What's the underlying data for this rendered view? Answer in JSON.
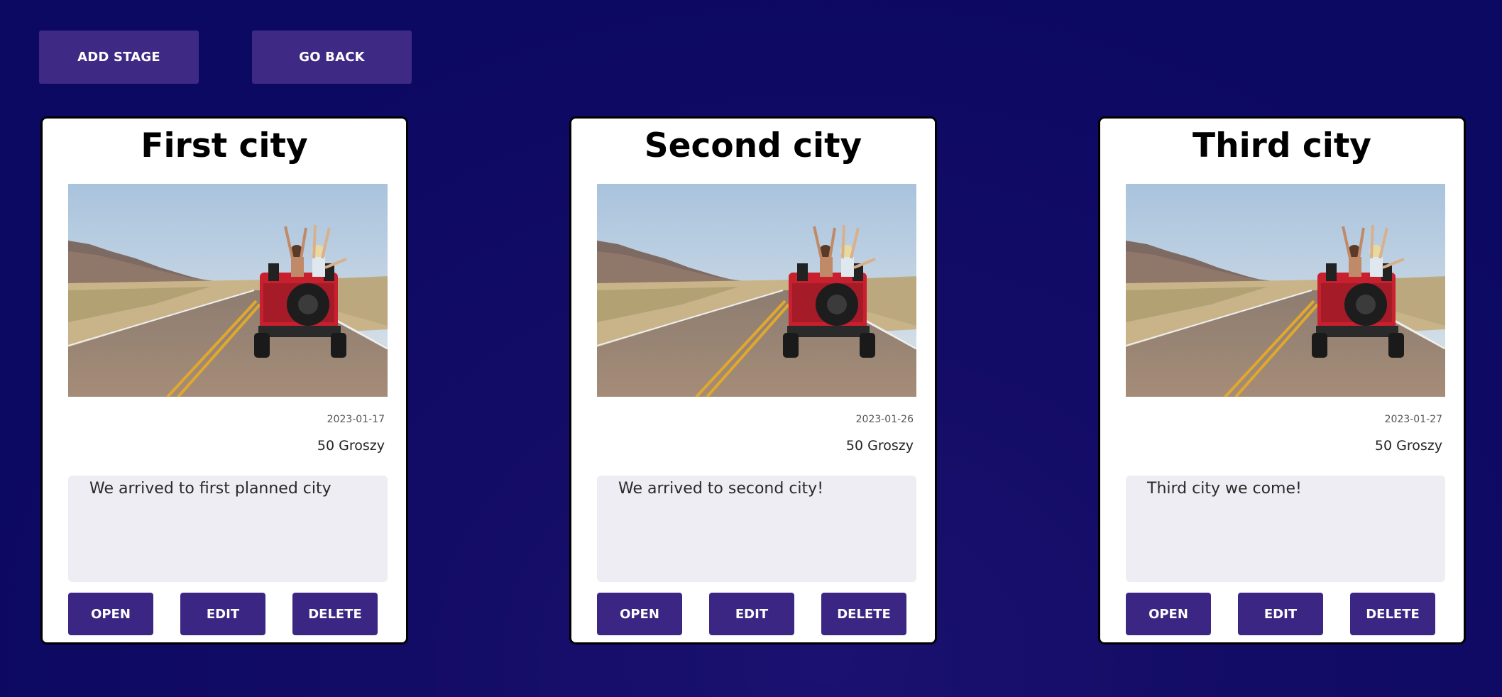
{
  "toolbar": {
    "add_stage_label": "ADD STAGE",
    "go_back_label": "GO BACK"
  },
  "stages": [
    {
      "title": "First city",
      "date": "2023-01-17",
      "price": "50 Groszy",
      "description": "We arrived to first planned city",
      "open_label": "OPEN",
      "edit_label": "EDIT",
      "delete_label": "DELETE"
    },
    {
      "title": "Second city",
      "date": "2023-01-26",
      "price": "50 Groszy",
      "description": "We arrived to second city!",
      "open_label": "OPEN",
      "edit_label": "EDIT",
      "delete_label": "DELETE"
    },
    {
      "title": "Third city",
      "date": "2023-01-27",
      "price": "50 Groszy",
      "description": "Third city we come!",
      "open_label": "OPEN",
      "edit_label": "EDIT",
      "delete_label": "DELETE"
    }
  ],
  "colors": {
    "background": "#0c0963",
    "button": "#3e2a85",
    "card_button": "#3b2783",
    "card": "#ffffff",
    "description_bg": "#eeedf3"
  }
}
